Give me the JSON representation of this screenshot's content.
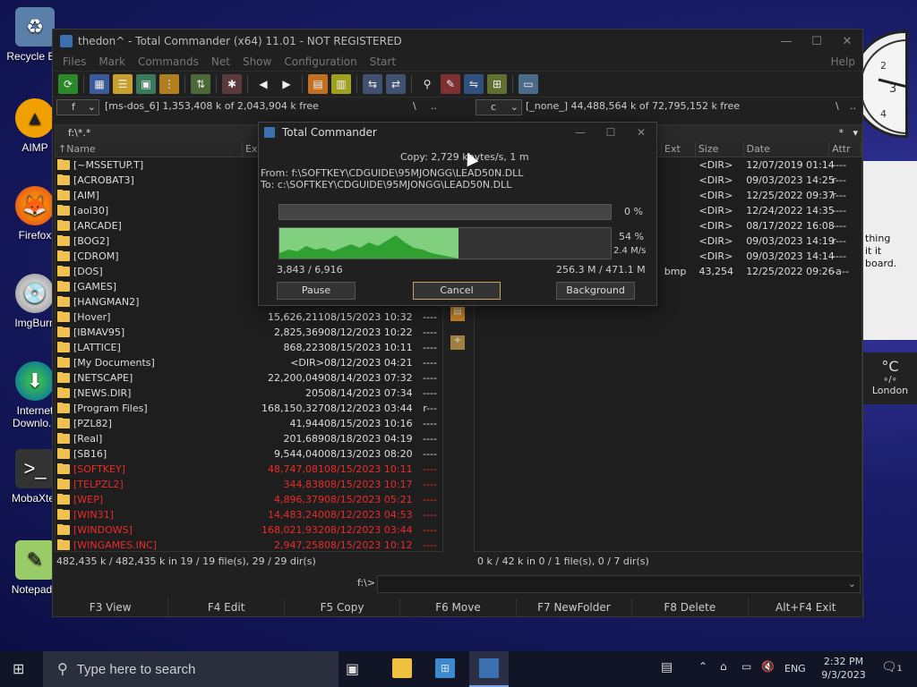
{
  "desktop": {
    "icons": [
      {
        "label": "Recycle Bin",
        "icon": "recycle-bin-icon"
      },
      {
        "label": "AIMP",
        "icon": "aimp-icon"
      },
      {
        "label": "Firefox",
        "icon": "firefox-icon"
      },
      {
        "label": "ImgBurn",
        "icon": "imgburn-icon"
      },
      {
        "label": "Internet Downlo...",
        "icon": "download-icon"
      },
      {
        "label": "MobaXter",
        "icon": "terminal-icon"
      },
      {
        "label": "Notepad+",
        "icon": "notepad-icon"
      }
    ]
  },
  "window": {
    "title": "thedon^ - Total Commander (x64) 11.01 - NOT REGISTERED",
    "menu": [
      "Files",
      "Mark",
      "Commands",
      "Net",
      "Show",
      "Configuration",
      "Start"
    ],
    "help": "Help"
  },
  "left": {
    "drive": "f",
    "drive_info": "[ms-dos_6]  1,353,408 k of 2,043,904 k free",
    "root": "\\",
    "up": "..",
    "path": "f:\\*.*",
    "headers": {
      "name": "Name",
      "ext": "Ext",
      "size": "Size",
      "date": "Date",
      "attr": "Attr"
    },
    "rows": [
      {
        "name": "[~MSSETUP.T]",
        "size": "",
        "date": "",
        "attr": "",
        "red": false
      },
      {
        "name": "[ACROBAT3]",
        "size": "",
        "date": "",
        "attr": "",
        "red": false
      },
      {
        "name": "[AIM]",
        "size": "",
        "date": "",
        "attr": "",
        "red": false
      },
      {
        "name": "[aol30]",
        "size": "",
        "date": "",
        "attr": "",
        "red": false
      },
      {
        "name": "[ARCADE]",
        "size": "",
        "date": "",
        "attr": "",
        "red": false
      },
      {
        "name": "[BOG2]",
        "size": "",
        "date": "",
        "attr": "",
        "red": false
      },
      {
        "name": "[CDROM]",
        "size": "",
        "date": "",
        "attr": "",
        "red": false
      },
      {
        "name": "[DOS]",
        "size": "",
        "date": "",
        "attr": "",
        "red": false
      },
      {
        "name": "[GAMES]",
        "size": "",
        "date": "",
        "attr": "",
        "red": false
      },
      {
        "name": "[HANGMAN2]",
        "size": "",
        "date": "",
        "attr": "",
        "red": false
      },
      {
        "name": "[Hover]",
        "size": "15,626,211",
        "date": "08/15/2023 10:32",
        "attr": "----",
        "red": false
      },
      {
        "name": "[IBMAV95]",
        "size": "2,825,369",
        "date": "08/12/2023 10:22",
        "attr": "----",
        "red": false
      },
      {
        "name": "[LATTICE]",
        "size": "868,223",
        "date": "08/15/2023 10:11",
        "attr": "----",
        "red": false
      },
      {
        "name": "[My Documents]",
        "size": "<DIR>",
        "date": "08/12/2023 04:21",
        "attr": "----",
        "red": false
      },
      {
        "name": "[NETSCAPE]",
        "size": "22,200,049",
        "date": "08/14/2023 07:32",
        "attr": "----",
        "red": false
      },
      {
        "name": "[NEWS.DIR]",
        "size": "205",
        "date": "08/14/2023 07:34",
        "attr": "----",
        "red": false
      },
      {
        "name": "[Program Files]",
        "size": "168,150,327",
        "date": "08/12/2023 03:44",
        "attr": "r---",
        "red": false
      },
      {
        "name": "[PZL82]",
        "size": "41,944",
        "date": "08/15/2023 10:16",
        "attr": "----",
        "red": false
      },
      {
        "name": "[Real]",
        "size": "201,689",
        "date": "08/18/2023 04:19",
        "attr": "----",
        "red": false
      },
      {
        "name": "[SB16]",
        "size": "9,544,040",
        "date": "08/13/2023 08:20",
        "attr": "----",
        "red": false
      },
      {
        "name": "[SOFTKEY]",
        "size": "48,747,081",
        "date": "08/15/2023 10:11",
        "attr": "----",
        "red": true
      },
      {
        "name": "[TELPZL2]",
        "size": "344,838",
        "date": "08/15/2023 10:17",
        "attr": "----",
        "red": true
      },
      {
        "name": "[WEP]",
        "size": "4,896,379",
        "date": "08/15/2023 05:21",
        "attr": "----",
        "red": true
      },
      {
        "name": "[WIN31]",
        "size": "14,483,240",
        "date": "08/12/2023 04:53",
        "attr": "----",
        "red": true
      },
      {
        "name": "[WINDOWS]",
        "size": "168,021,932",
        "date": "08/12/2023 03:44",
        "attr": "----",
        "red": true
      },
      {
        "name": "[WINGAMES.INC]",
        "size": "2,947,258",
        "date": "08/15/2023 10:12",
        "attr": "----",
        "red": true
      }
    ],
    "status": "482,435 k / 482,435 k in 19 / 19 file(s), 29 / 29 dir(s)"
  },
  "right": {
    "drive": "c",
    "drive_info": "[_none_]  44,488,564 k of 72,795,152 k free",
    "root": "\\",
    "up": "..",
    "star": "*",
    "headers": {
      "ext": "Ext",
      "size": "Size",
      "date": "Date",
      "attr": "Attr"
    },
    "rows": [
      {
        "ext": "",
        "size": "<DIR>",
        "date": "12/07/2019 01:14",
        "attr": "----"
      },
      {
        "ext": "",
        "size": "<DIR>",
        "date": "09/03/2023 14:25",
        "attr": "r---"
      },
      {
        "ext": "",
        "size": "<DIR>",
        "date": "12/25/2022 09:37",
        "attr": "r---"
      },
      {
        "ext": "",
        "size": "<DIR>",
        "date": "12/24/2022 14:35",
        "attr": "----"
      },
      {
        "ext": "",
        "size": "<DIR>",
        "date": "08/17/2022 16:08",
        "attr": "----"
      },
      {
        "ext": "",
        "size": "<DIR>",
        "date": "09/03/2023 14:19",
        "attr": "r---"
      },
      {
        "ext": "",
        "size": "<DIR>",
        "date": "09/03/2023 14:14",
        "attr": "----"
      },
      {
        "ext": "bmp",
        "size": "43,254",
        "date": "12/25/2022 09:26",
        "attr": "-a--"
      }
    ],
    "status": "0 k / 42 k in 0 / 1 file(s), 0 / 7 dir(s)"
  },
  "cmd": {
    "prompt": "f:\\>"
  },
  "fkeys": [
    "F3 View",
    "F4 Edit",
    "F5 Copy",
    "F6 Move",
    "F7 NewFolder",
    "F8 Delete",
    "Alt+F4 Exit"
  ],
  "dialog": {
    "title": "Total Commander",
    "speed": "Copy: 2,729 kbytes/s, 1 m",
    "from": "From: f:\\SOFTKEY\\CDGUIDE\\95MJONGG\\LEAD50N.DLL",
    "to": "To:  c:\\SOFTKEY\\CDGUIDE\\95MJONGG\\LEAD50N.DLL",
    "file_percent": "0 %",
    "file_progress": 0,
    "total_percent": "54 %",
    "total_progress": 0.54,
    "rate": "2.4 M/s",
    "count": "3,843 / 6,916",
    "bytes": "256.3 M / 471.1 M",
    "pause": "Pause",
    "cancel": "Cancel",
    "background": "Background"
  },
  "widgets": {
    "weather_unit": "°C",
    "weather_city": "London",
    "note_text": "thing\nit it\nboard."
  },
  "taskbar": {
    "search_placeholder": "Type here to search",
    "lang": "ENG",
    "time": "2:32 PM",
    "date": "9/3/2023",
    "notif_count": "1"
  }
}
